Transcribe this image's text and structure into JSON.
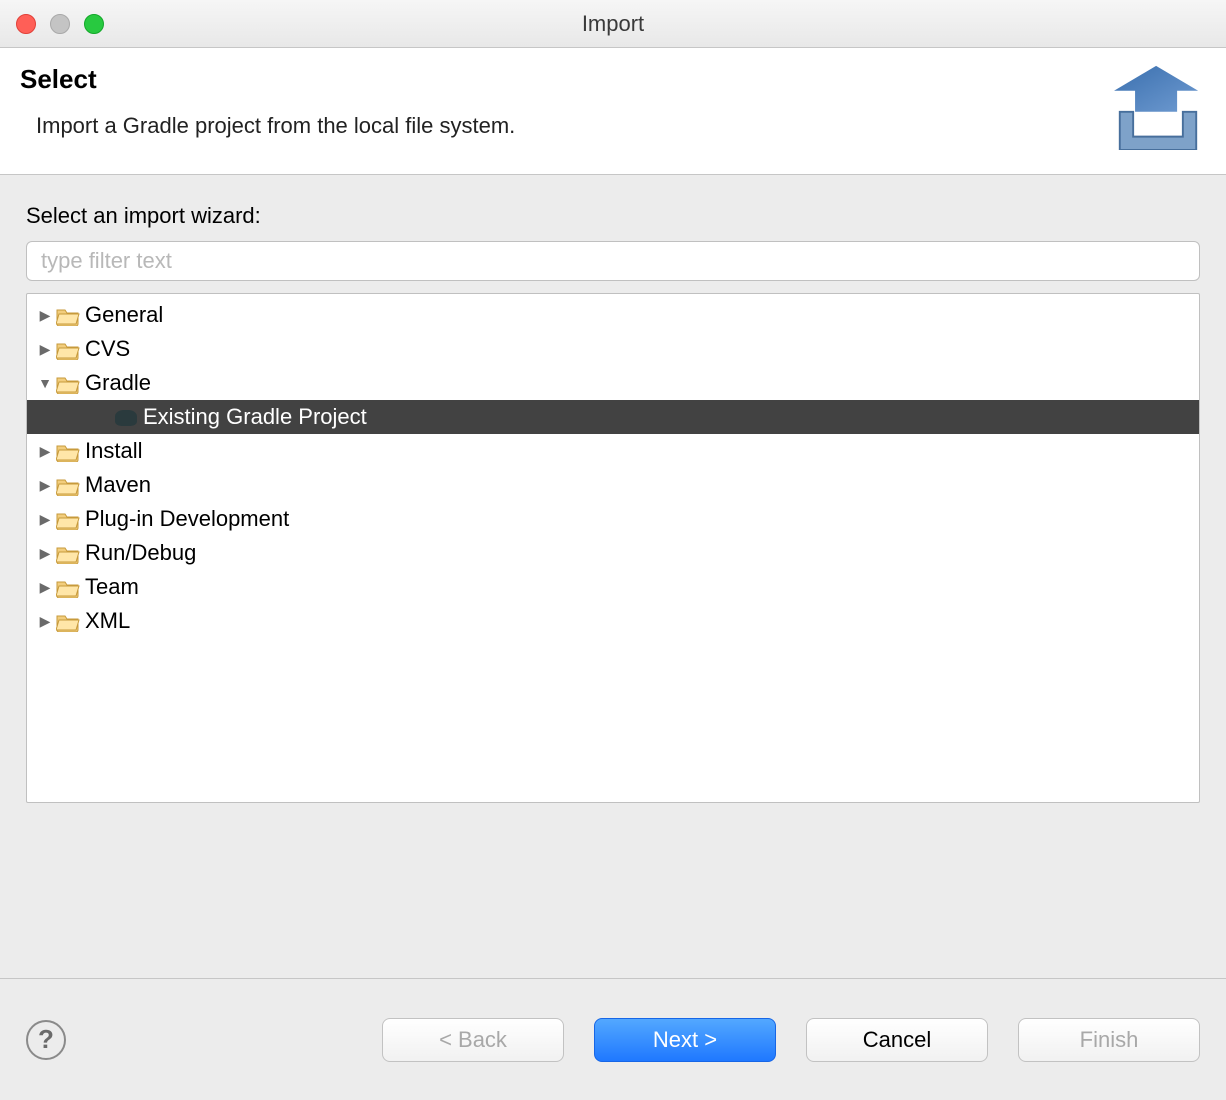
{
  "window": {
    "title": "Import"
  },
  "header": {
    "heading": "Select",
    "subheading": "Import a Gradle project from the local file system."
  },
  "body": {
    "prompt": "Select an import wizard:",
    "filter_placeholder": "type filter text"
  },
  "tree": {
    "items": [
      {
        "label": "General",
        "expanded": false,
        "level": 0,
        "kind": "folder"
      },
      {
        "label": "CVS",
        "expanded": false,
        "level": 0,
        "kind": "folder"
      },
      {
        "label": "Gradle",
        "expanded": true,
        "level": 0,
        "kind": "folder"
      },
      {
        "label": "Existing Gradle Project",
        "expanded": false,
        "level": 1,
        "kind": "leaf",
        "selected": true
      },
      {
        "label": "Install",
        "expanded": false,
        "level": 0,
        "kind": "folder"
      },
      {
        "label": "Maven",
        "expanded": false,
        "level": 0,
        "kind": "folder"
      },
      {
        "label": "Plug-in Development",
        "expanded": false,
        "level": 0,
        "kind": "folder"
      },
      {
        "label": "Run/Debug",
        "expanded": false,
        "level": 0,
        "kind": "folder"
      },
      {
        "label": "Team",
        "expanded": false,
        "level": 0,
        "kind": "folder"
      },
      {
        "label": "XML",
        "expanded": false,
        "level": 0,
        "kind": "folder"
      }
    ]
  },
  "footer": {
    "back": "< Back",
    "next": "Next >",
    "cancel": "Cancel",
    "finish": "Finish"
  }
}
